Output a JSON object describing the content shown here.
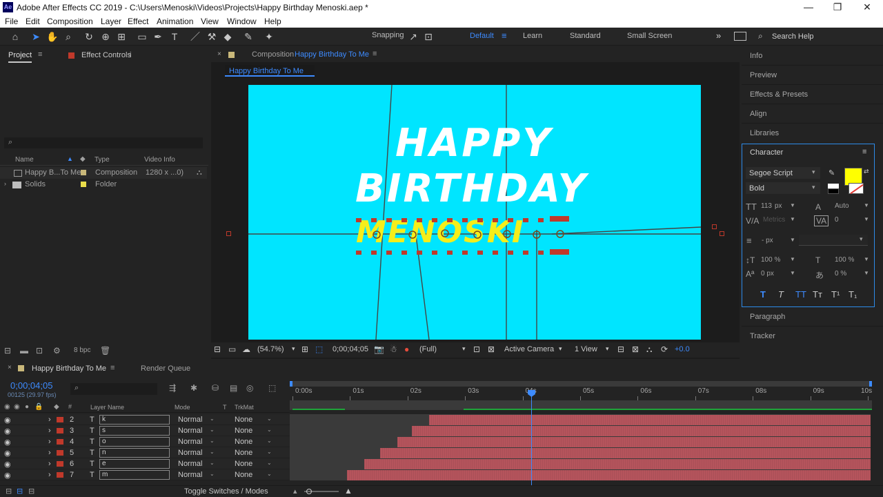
{
  "window": {
    "app_badge": "Ae",
    "title": "Adobe After Effects CC 2019 - C:\\Users\\Menoski\\Videos\\Projects\\Happy Birthday Menoski.aep *",
    "minimize": "—",
    "restore": "❐",
    "close": "✕"
  },
  "menu": [
    "File",
    "Edit",
    "Composition",
    "Layer",
    "Effect",
    "Animation",
    "View",
    "Window",
    "Help"
  ],
  "toolbar": {
    "snapping_label": "Snapping",
    "workspaces": [
      "Default",
      "Learn",
      "Standard",
      "Small Screen"
    ],
    "active_workspace": "Default",
    "search_placeholder": "Search Help"
  },
  "project_panel": {
    "tab_project": "Project",
    "tab_effect_controls": "Effect Controls",
    "effect_controls_suffix": "i",
    "columns": {
      "name": "Name",
      "type": "Type",
      "video_info": "Video Info"
    },
    "items": [
      {
        "name": "Happy B...To Me",
        "type": "Composition",
        "info": "1280 x ...0)",
        "color": "#c9b87a"
      },
      {
        "name": "Solids",
        "type": "Folder",
        "info": "",
        "color": "#e9dd4a"
      }
    ],
    "bpc": "8 bpc"
  },
  "composition": {
    "tab_prefix": "Composition",
    "tab_name": "Happy Birthday To Me",
    "breadcrumb": "Happy Birthday To Me",
    "canvas_text_line1": "HAPPY",
    "canvas_text_line2": "BIRTHDAY",
    "canvas_text_line3": "MENOSKI",
    "bg_color": "#00e5ff",
    "footer": {
      "zoom": "(54.7%)",
      "timecode": "0;00;04;05",
      "resolution": "(Full)",
      "camera": "Active Camera",
      "views": "1 View",
      "exposure": "+0.0"
    }
  },
  "right_panels": {
    "items": [
      "Info",
      "Preview",
      "Effects & Presets",
      "Align",
      "Libraries"
    ],
    "character_title": "Character",
    "font_family": "Segoe Script",
    "font_style": "Bold",
    "font_size": "113",
    "font_size_unit": "px",
    "leading": "Auto",
    "kerning": "Metrics",
    "tracking": "0",
    "stroke_width": "- px",
    "vert_scale": "100 %",
    "horiz_scale": "100 %",
    "baseline": "0 px",
    "tsume": "0 %",
    "fill_color": "#ffff00",
    "bottom_items": [
      "Paragraph",
      "Tracker"
    ]
  },
  "timeline": {
    "tab_name": "Happy Birthday To Me",
    "render_queue": "Render Queue",
    "current_time": "0;00;04;05",
    "frame_info": "00125 (29.97 fps)",
    "columns": {
      "layer_name": "Layer Name",
      "mode": "Mode",
      "t": "T",
      "trkmat": "TrkMat"
    },
    "ruler": [
      "0:00s",
      "01s",
      "02s",
      "03s",
      "04s",
      "05s",
      "06s",
      "07s",
      "08s",
      "09s",
      "10s"
    ],
    "layers": [
      {
        "num": "2",
        "name": "k",
        "mode": "Normal",
        "trkmat": "None",
        "start": 0.24
      },
      {
        "num": "3",
        "name": "s",
        "mode": "Normal",
        "trkmat": "None",
        "start": 0.21
      },
      {
        "num": "4",
        "name": "o",
        "mode": "Normal",
        "trkmat": "None",
        "start": 0.185
      },
      {
        "num": "5",
        "name": "n",
        "mode": "Normal",
        "trkmat": "None",
        "start": 0.155
      },
      {
        "num": "6",
        "name": "e",
        "mode": "Normal",
        "trkmat": "None",
        "start": 0.128
      },
      {
        "num": "7",
        "name": "m",
        "mode": "Normal",
        "trkmat": "None",
        "start": 0.098
      }
    ],
    "toggle_label": "Toggle Switches / Modes"
  }
}
